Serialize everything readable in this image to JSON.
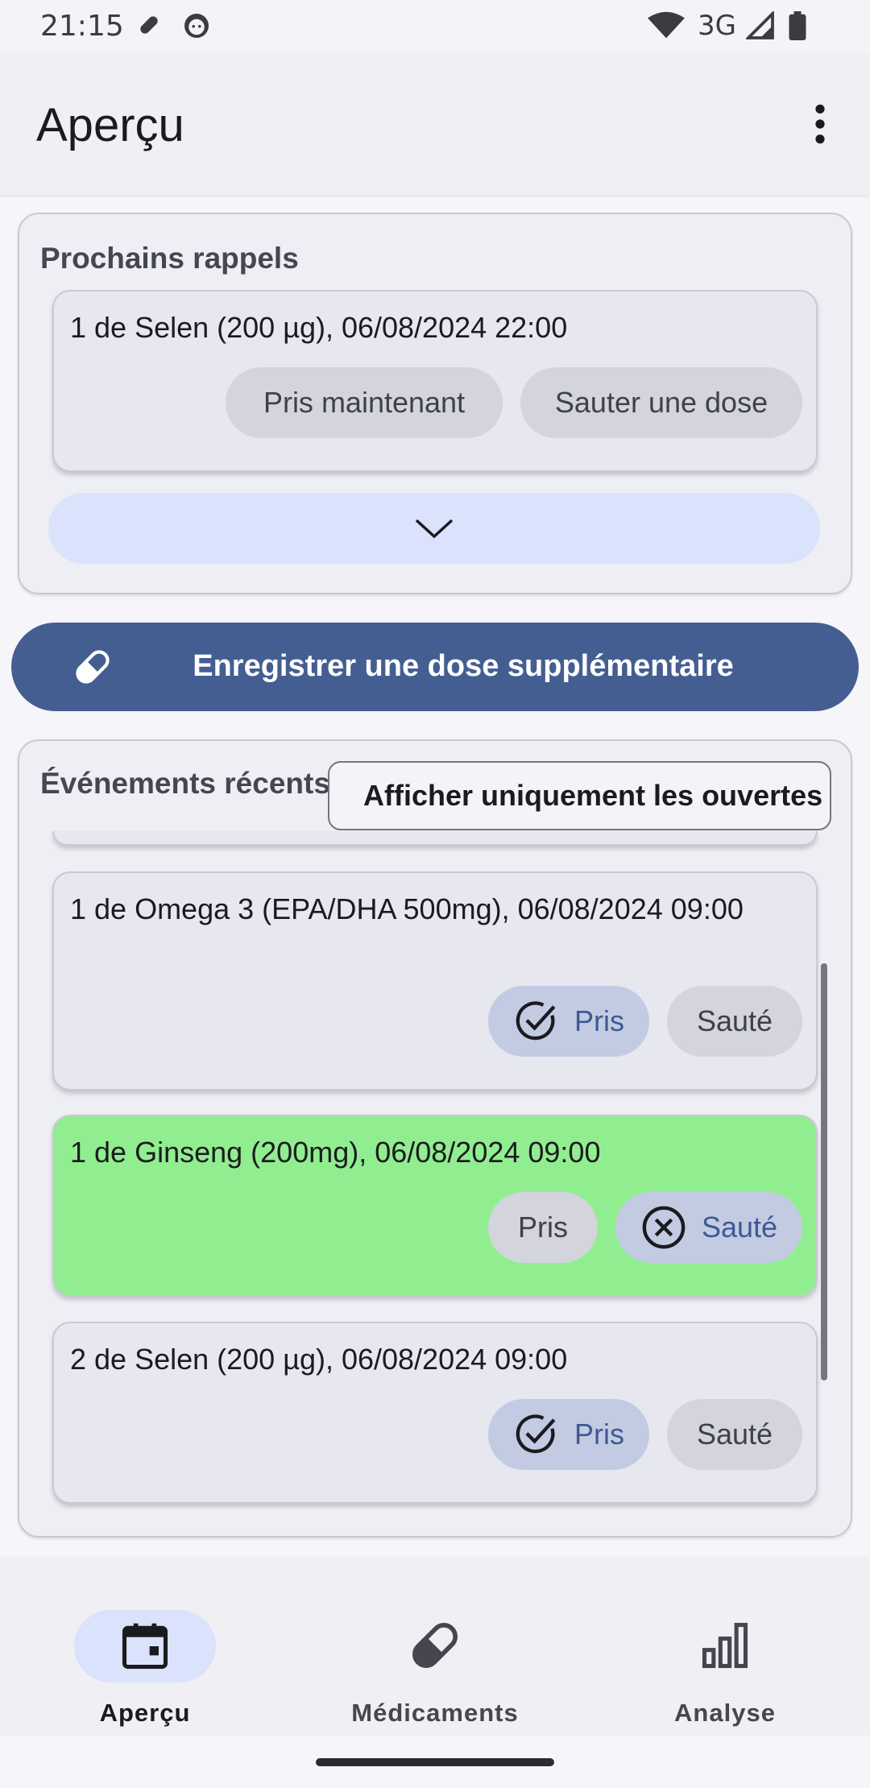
{
  "status_bar": {
    "time": "21:15",
    "network": "3G"
  },
  "app_bar": {
    "title": "Aperçu"
  },
  "reminders": {
    "title": "Prochains rappels",
    "items": [
      {
        "text": "1 de Selen (200 µg), 06/08/2024 22:00",
        "take_label": "Pris maintenant",
        "skip_label": "Sauter une dose"
      }
    ]
  },
  "extra_dose": {
    "label": "Enregistrer une dose supplémentaire"
  },
  "recent": {
    "title": "Événements récents",
    "filter_label": "Afficher uniquement les ouvertes",
    "items": [
      {
        "text": "1 de Omega 3 (EPA/DHA 500mg), 06/08/2024 09:00",
        "taken_label": "Pris",
        "skipped_label": "Sauté",
        "state": "taken"
      },
      {
        "text": "1 de Ginseng (200mg), 06/08/2024 09:00",
        "taken_label": "Pris",
        "skipped_label": "Sauté",
        "state": "skipped"
      },
      {
        "text": "2 de Selen (200 µg), 06/08/2024 09:00",
        "taken_label": "Pris",
        "skipped_label": "Sauté",
        "state": "taken"
      }
    ]
  },
  "bottom_nav": {
    "items": [
      {
        "label": "Aperçu",
        "icon": "calendar-icon",
        "active": true
      },
      {
        "label": "Médicaments",
        "icon": "pill-icon",
        "active": false
      },
      {
        "label": "Analyse",
        "icon": "bar-chart-icon",
        "active": false
      }
    ]
  },
  "colors": {
    "primary": "#445e91",
    "skipped_highlight": "#90ee90",
    "selected_pill": "#c3cbe3",
    "nav_indicator": "#dbe2fb"
  }
}
